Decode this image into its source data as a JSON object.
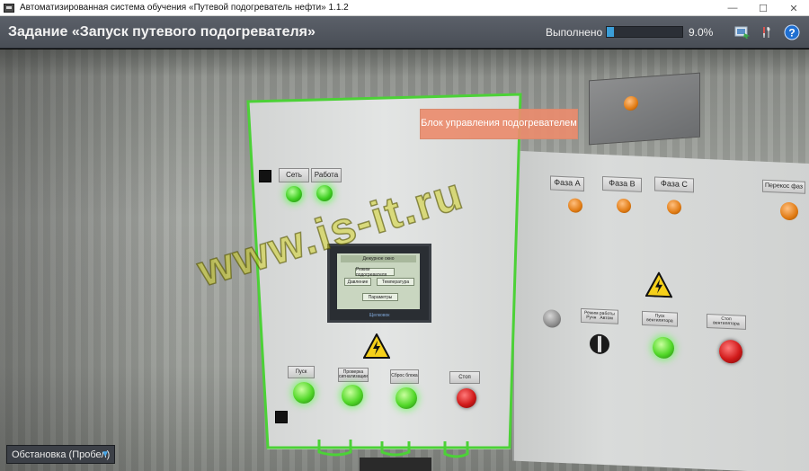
{
  "window": {
    "title": "Автоматизированная система обучения «Путевой подогреватель нефти» 1.1.2",
    "controls": {
      "minimize": "—",
      "maximize": "☐",
      "close": "✕"
    }
  },
  "header": {
    "task_title": "Задание «Запуск путевого подогревателя»",
    "progress_label": "Выполнено",
    "progress_value": "9.0%",
    "progress_fraction": 0.09,
    "icons": [
      "screenshot-icon",
      "tools-icon",
      "help-icon"
    ]
  },
  "main_cabinet": {
    "top_labels": [
      "Сеть",
      "Работа"
    ],
    "screen": {
      "header": "Дежурное окно",
      "rows": [
        "Режим подогревателя",
        "Давление",
        "Температура",
        "Параметры"
      ],
      "footer": "Щелковок"
    },
    "bottom_labels": [
      "Пуск",
      "Проверка сигнализации",
      "Сброс блока",
      "Стоп"
    ]
  },
  "right_cabinet": {
    "phase_labels": [
      "Фаза А",
      "Фаза В",
      "Фаза С",
      "Перекос фаз"
    ],
    "mode_switch_label": "Режим работы",
    "mode_switch_options": [
      "Ручн",
      "Автом"
    ],
    "start_label": "Пуск вентилятора",
    "stop_label": "Стоп вентилятора"
  },
  "tooltip": "Блок управления подогревателем",
  "watermark": "www.is-it.ru",
  "scene_dropdown": {
    "value": "Обстановка (Пробел)"
  },
  "colors": {
    "progress": "#3b9ed8",
    "highlight": "#4cd137",
    "tooltip": "#ea8c6e"
  }
}
